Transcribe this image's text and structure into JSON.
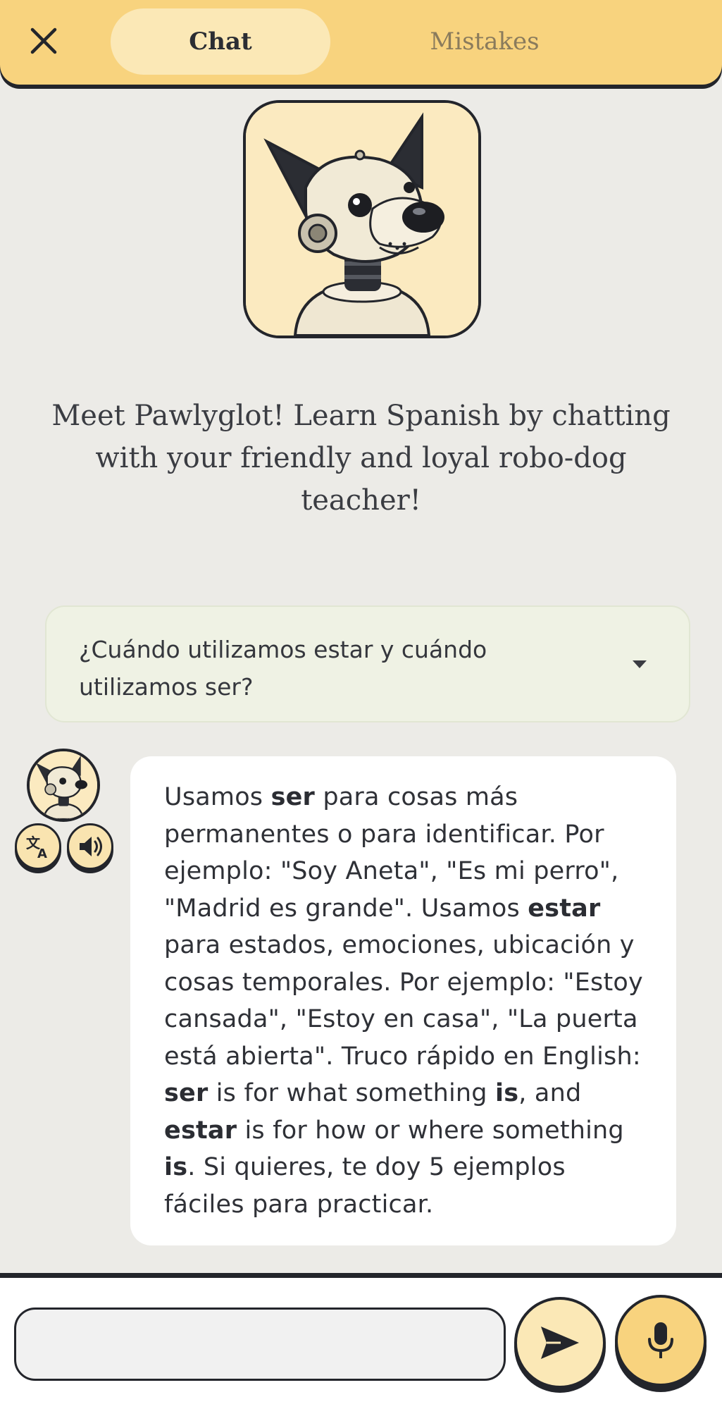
{
  "header": {
    "close_icon": "close-icon",
    "tabs": [
      {
        "label": "Chat",
        "active": true
      },
      {
        "label": "Mistakes",
        "active": false
      }
    ]
  },
  "hero": {
    "avatar_icon": "robo-dog-avatar",
    "intro": "Meet Pawlyglot! Learn Spanish by chatting with your friendly and loyal robo-dog teacher!"
  },
  "question": {
    "text": "¿Cuándo utilizamos estar y cuándo utilizamos ser?",
    "icon": "chevron-down-icon"
  },
  "message": {
    "segments": [
      {
        "t": "Usamos ",
        "b": false
      },
      {
        "t": "ser",
        "b": true
      },
      {
        "t": " para cosas más permanentes o para identificar. Por ejemplo: \"Soy Aneta\", \"Es mi perro\", \"Madrid es grande\". Usamos ",
        "b": false
      },
      {
        "t": "estar",
        "b": true
      },
      {
        "t": " para estados, emociones, ubicación y cosas temporales. Por ejemplo: \"Estoy cansada\", \"Estoy en casa\", \"La puerta está abierta\". Truco rápido en English: ",
        "b": false
      },
      {
        "t": "ser",
        "b": true
      },
      {
        "t": " is for what something ",
        "b": false
      },
      {
        "t": "is",
        "b": true
      },
      {
        "t": ", and ",
        "b": false
      },
      {
        "t": "estar",
        "b": true
      },
      {
        "t": " is for how or where something ",
        "b": false
      },
      {
        "t": "is",
        "b": true
      },
      {
        "t": ". Si quieres, te doy 5 ejemplos fáciles para practicar.",
        "b": false
      }
    ],
    "actions": [
      "translate-icon",
      "speaker-icon"
    ]
  },
  "composer": {
    "placeholder": "",
    "send_icon": "send-icon",
    "mic_icon": "microphone-icon"
  },
  "colors": {
    "header": "#f8d37e",
    "active_tab": "#fbe8b6",
    "background": "#ecebe7",
    "question_bg": "#eff2e4",
    "outline": "#23252b"
  }
}
